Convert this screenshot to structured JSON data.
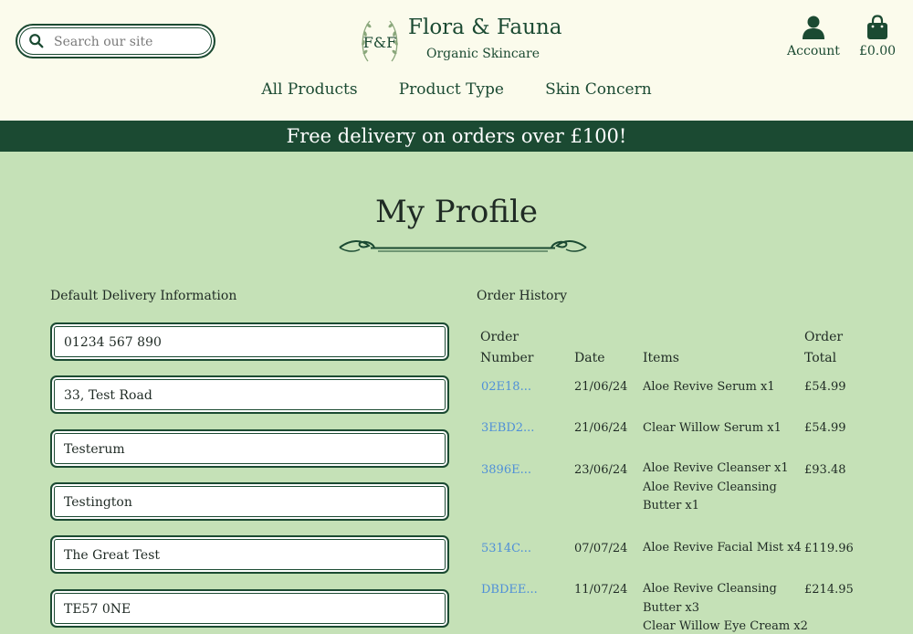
{
  "header": {
    "search_placeholder": "Search our site",
    "logo_monogram": "F&F",
    "brand_name": "Flora & Fauna",
    "brand_sub": "Organic Skincare",
    "account_label": "Account",
    "cart_label": "£0.00"
  },
  "nav": {
    "items": [
      "All Products",
      "Product Type",
      "Skin Concern"
    ]
  },
  "banner": {
    "text": "Free delivery on orders over £100!"
  },
  "profile": {
    "title": "My Profile",
    "delivery_heading": "Default Delivery Information",
    "fields": [
      "01234 567 890",
      "33, Test Road",
      "Testerum",
      "Testington",
      "The Great Test",
      "TE57 0NE"
    ]
  },
  "orders": {
    "heading": "Order History",
    "columns": {
      "number_1": "Order",
      "number_2": "Number",
      "date": "Date",
      "items": "Items",
      "total_1": "Order",
      "total_2": "Total"
    },
    "rows": [
      {
        "number": "02E18...",
        "date": "21/06/24",
        "items": [
          "Aloe Revive Serum x1"
        ],
        "total": "£54.99"
      },
      {
        "number": "3EBD2...",
        "date": "21/06/24",
        "items": [
          "Clear Willow Serum x1"
        ],
        "total": "£54.99"
      },
      {
        "number": "3896E...",
        "date": "23/06/24",
        "items": [
          "Aloe Revive Cleanser x1",
          "Aloe Revive Cleansing",
          "Butter x1"
        ],
        "total": "£93.48"
      },
      {
        "number": "5314C...",
        "date": "07/07/24",
        "items": [
          "Aloe Revive Facial Mist x4"
        ],
        "total": "£119.96"
      },
      {
        "number": "DBDEE...",
        "date": "11/07/24",
        "items": [
          "Aloe Revive Cleansing",
          "Butter x3",
          "Clear Willow Eye Cream x2"
        ],
        "total": "£214.95"
      }
    ]
  },
  "colors": {
    "primary": "#1b4a32",
    "header_bg": "#fbfbec",
    "page_bg": "#c5e1b7",
    "link": "#4f8fd8"
  }
}
